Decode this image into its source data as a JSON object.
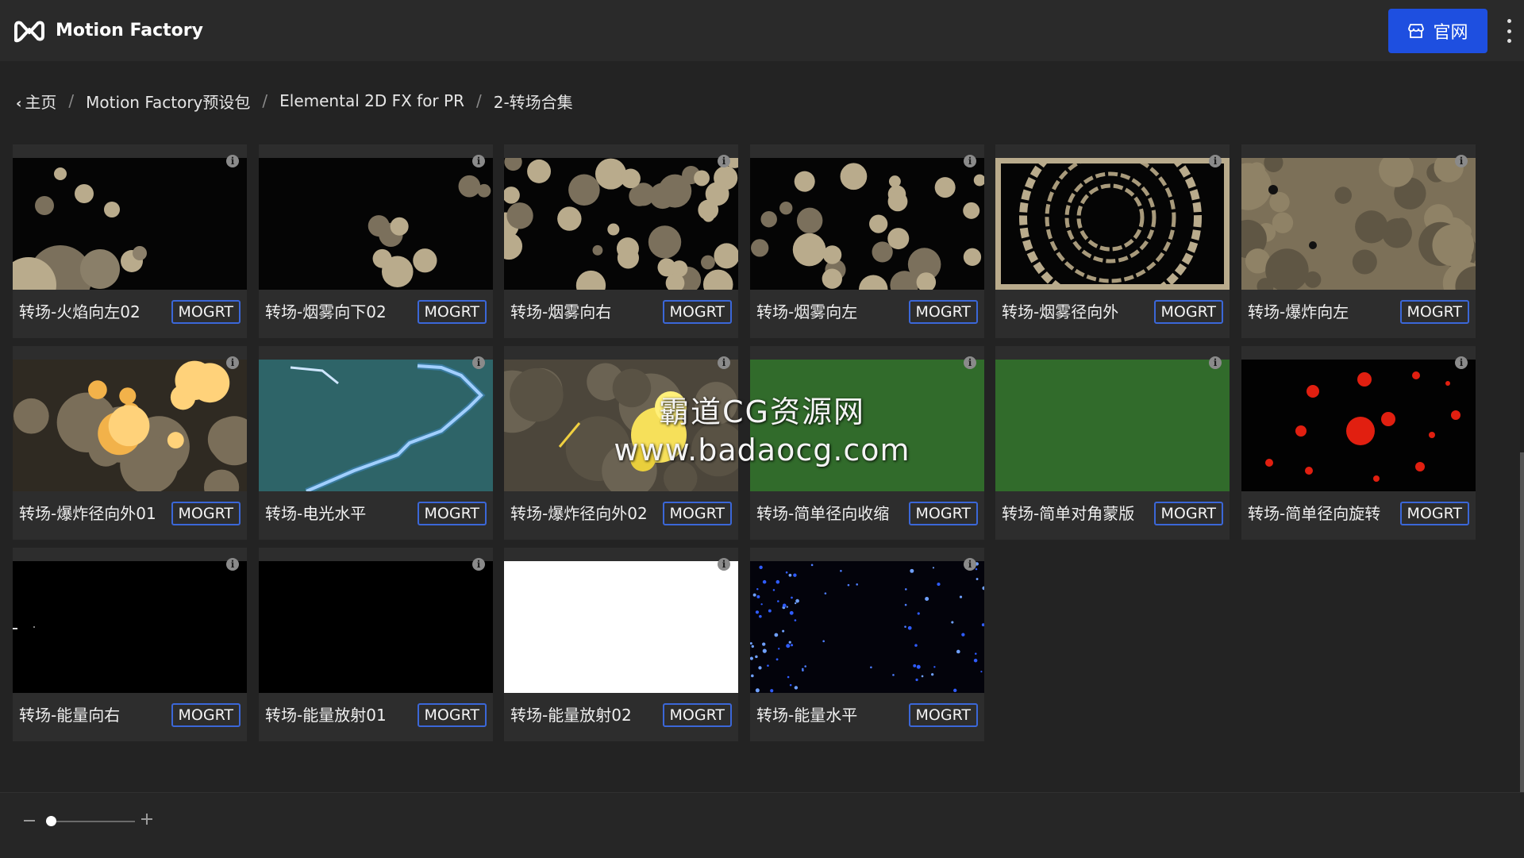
{
  "header": {
    "app_name": "Motion Factory",
    "official_button_label": "官网",
    "icons": {
      "logo": "motion-factory-logo",
      "store": "store-icon",
      "menu": "more-vertical-icon"
    },
    "accent_color": "#1e4fe0"
  },
  "breadcrumb": {
    "items": [
      "主页",
      "Motion Factory预设包",
      "Elemental 2D FX for PR",
      "2-转场合集"
    ],
    "separator": "/"
  },
  "grid": {
    "badge_label": "MOGRT",
    "cards": [
      {
        "name": "转场-火焰向左02",
        "thumb": "smoke-left"
      },
      {
        "name": "转场-烟雾向下02",
        "thumb": "smoke-down"
      },
      {
        "name": "转场-烟雾向右",
        "thumb": "smoke-right"
      },
      {
        "name": "转场-烟雾向左",
        "thumb": "smoke-scatter"
      },
      {
        "name": "转场-烟雾径向外",
        "thumb": "smoke-rings"
      },
      {
        "name": "转场-爆炸向左",
        "thumb": "explosion-left"
      },
      {
        "name": "转场-爆炸径向外01",
        "thumb": "explosion-fire"
      },
      {
        "name": "转场-电光水平",
        "thumb": "lightning"
      },
      {
        "name": "转场-爆炸径向外02",
        "thumb": "explosion-yellow"
      },
      {
        "name": "转场-简单径向收缩",
        "thumb": "green"
      },
      {
        "name": "转场-简单对角蒙版",
        "thumb": "green"
      },
      {
        "name": "转场-简单径向旋转",
        "thumb": "red-dots"
      },
      {
        "name": "转场-能量向右",
        "thumb": "black-dots"
      },
      {
        "name": "转场-能量放射01",
        "thumb": "black"
      },
      {
        "name": "转场-能量放射02",
        "thumb": "white"
      },
      {
        "name": "转场-能量水平",
        "thumb": "blue-sparks"
      }
    ]
  },
  "watermark": {
    "line1": "霸道CG资源网",
    "line2": "www.badaocg.com"
  },
  "footer": {
    "zoom_level": 0.05
  }
}
